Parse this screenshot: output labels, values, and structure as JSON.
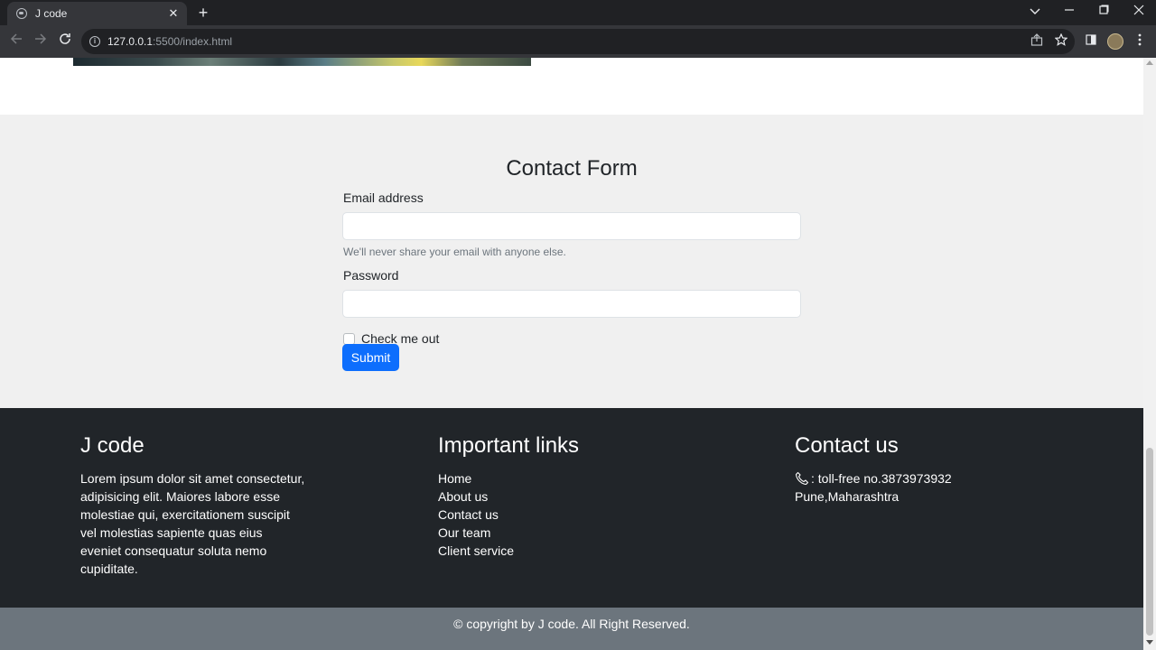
{
  "browser": {
    "tab_title": "J code",
    "tab_close": "✕",
    "new_tab": "+",
    "url_host": "127.0.0.1",
    "url_path": ":5500/index.html",
    "icons": [
      "back-icon",
      "forward-icon",
      "reload-icon",
      "info-icon",
      "share-icon",
      "bookmark-star-icon",
      "side-panel-icon",
      "avatar",
      "menu-icon",
      "tab-list-icon",
      "minimize-icon",
      "maximize-icon",
      "close-icon"
    ]
  },
  "contact_form": {
    "title": "Contact Form",
    "email_label": "Email address",
    "email_value": "",
    "email_help": "We'll never share your email with anyone else.",
    "password_label": "Password",
    "password_value": "",
    "checkbox_label": "Check me out",
    "submit_label": "Submit"
  },
  "footer": {
    "brand": {
      "heading": "J code",
      "text": "Lorem ipsum dolor sit amet consectetur, adipisicing elit. Maiores labore esse molestiae qui, exercitationem suscipit vel molestias sapiente quas eius eveniet consequatur soluta nemo cupiditate."
    },
    "links": {
      "heading": "Important links",
      "items": [
        "Home",
        "About us",
        "Contact us",
        "Our team",
        "Client service"
      ]
    },
    "contact": {
      "heading": "Contact us",
      "phone": ": toll-free no.3873973932",
      "address": "Pune,Maharashtra"
    },
    "copyright": "© copyright by J code. All Right Reserved."
  },
  "colors": {
    "primary_button": "#0d6efd",
    "footer_bg": "#212529",
    "copyright_bg": "#6c757d",
    "form_section_bg": "#f0f0f0"
  }
}
